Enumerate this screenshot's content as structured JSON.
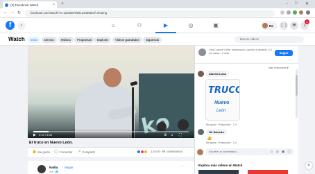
{
  "browser": {
    "tab_title": "(2) Facebook Watch",
    "new_tab": "+",
    "url": "facebook.com/watch/?v=1234567890123456&ref=sharing",
    "minimize": "–",
    "maximize": "□",
    "close": "✕"
  },
  "fb_nav": {
    "profile_name": "Ro",
    "notifications_count": "1"
  },
  "watch": {
    "title": "Watch",
    "chips": [
      "Inicio",
      "Directo",
      "Música",
      "Programas",
      "Explorar",
      "Videos guardados",
      "Siguiendo"
    ],
    "search_placeholder": "Buscar videos"
  },
  "video": {
    "current_time": "0:19 / 3:05",
    "progress_fraction": 0.1,
    "title": "El truco en Nuevo León.",
    "actions": {
      "like": "Me gusta",
      "comment": "Comentar",
      "share": "Compartir"
    },
    "reactions_text": "1,5 mil · 98 comentarios"
  },
  "side_panel": {
    "page_description": "Una Cuba al Chile: información, opinión y análisis. 3,2 mil vistas · 2 días",
    "follow_label": "Seguir",
    "sort_label": "Más relevantes ▾",
    "comments": [
      {
        "name": "Alberto Luna",
        "text": "",
        "actions": "Me gusta · Responder · 2 d"
      },
      {
        "name": "Gil Salcedo",
        "text": "👍",
        "actions": "Me gusta · Responder · 2 d"
      }
    ],
    "sticker_lines": [
      "TRUCO",
      "Nuevo",
      "León"
    ],
    "composer_placeholder": "Escribe un comentario...",
    "composer_icons": "☺ ◎ ▣ ☐"
  },
  "next_post": {
    "name": "Nadia",
    "follow": "· Seguir",
    "meta": "2 d · 🌐"
  },
  "more_watch": {
    "title": "Explora más videos en Watch"
  }
}
